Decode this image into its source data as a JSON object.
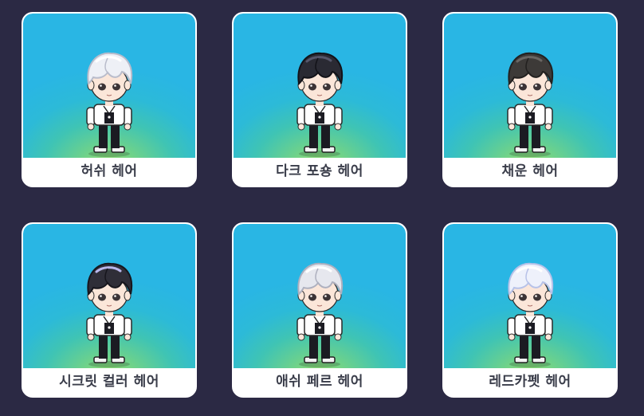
{
  "items": [
    {
      "name": "허쉬 헤어",
      "hair_color": "#eef0f6",
      "hair_shade": "#b9bccb",
      "hair_highlight": "#ffffff"
    },
    {
      "name": "다크 포숑 헤어",
      "hair_color": "#2a2a33",
      "hair_shade": "#121218",
      "hair_highlight": "#56566a"
    },
    {
      "name": "채운 헤어",
      "hair_color": "#3d3a38",
      "hair_shade": "#22201f",
      "hair_highlight": "#6a6663"
    },
    {
      "name": "시크릿 컬러 헤어",
      "hair_color": "#2f2e38",
      "hair_shade": "#17161d",
      "hair_highlight": "#b9b6ea"
    },
    {
      "name": "애쉬 페르 헤어",
      "hair_color": "#e6e7ee",
      "hair_shade": "#aeb0bf",
      "hair_highlight": "#ffffff"
    },
    {
      "name": "레드카펫 헤어",
      "hair_color": "#eef1fb",
      "hair_shade": "#b7c2e8",
      "hair_highlight": "#ffffff"
    }
  ],
  "palette": {
    "background": "#2b2944",
    "card_border": "#ffffff",
    "label_text": "#3a3d4a",
    "skin": "#fbe6d9",
    "eye": "#3b3336",
    "shirt": "#ffffff",
    "pants": "#1b1b22"
  }
}
